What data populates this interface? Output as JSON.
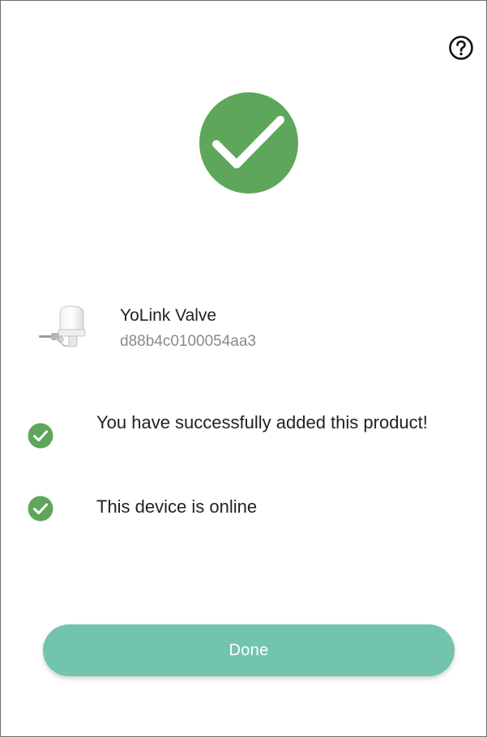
{
  "header": {
    "help_icon": "question-circle-icon"
  },
  "hero": {
    "icon": "large-check-circle-icon",
    "color": "#5ea65a"
  },
  "device": {
    "icon": "yolink-valve-device-icon",
    "name": "YoLink Valve",
    "id": "d88b4c0100054aa3"
  },
  "status": [
    {
      "icon": "check-circle-icon",
      "text": "You have successfully added this product!",
      "color": "#5ea65a"
    },
    {
      "icon": "check-circle-icon",
      "text": "This device is online",
      "color": "#5ea65a"
    }
  ],
  "actions": {
    "done_label": "Done",
    "done_color": "#72c4ad"
  }
}
